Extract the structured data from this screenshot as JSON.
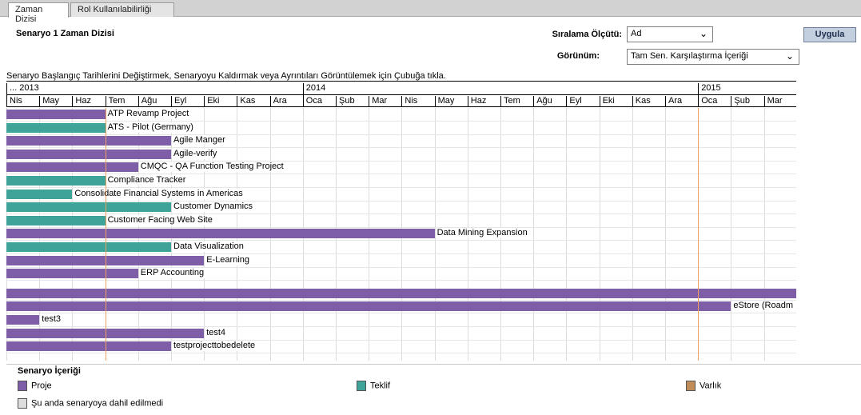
{
  "tabs": [
    {
      "label": "Zaman Dizisi",
      "active": true
    },
    {
      "label": "Rol Kullanılabilirliği",
      "active": false
    }
  ],
  "page_title": "Senaryo 1 Zaman Dizisi",
  "controls": {
    "sort_label": "Sıralama Ölçütü:",
    "sort_value": "Ad",
    "view_label": "Görünüm:",
    "view_value": "Tam Sen. Karşılaştırma İçeriği",
    "apply_label": "Uygula"
  },
  "instruction": "Senaryo Başlangıç Tarihlerini Değiştirmek, Senaryoyu Kaldırmak veya Ayrıntıları Görüntülemek için Çubuğa tıkla.",
  "timeline": {
    "years": [
      "... 2013",
      "2014",
      "2015"
    ],
    "months": [
      "Nis",
      "May",
      "Haz",
      "Tem",
      "Ağu",
      "Eyl",
      "Eki",
      "Kas",
      "Ara",
      "Oca",
      "Şub",
      "Mar",
      "Nis",
      "May",
      "Haz",
      "Tem",
      "Ağu",
      "Eyl",
      "Eki",
      "Kas",
      "Ara",
      "Oca",
      "Şub",
      "Mar"
    ],
    "rows": [
      {
        "name": "ATP Revamp Project",
        "type": "proj",
        "start": 0,
        "end": 3
      },
      {
        "name": "ATS - Pilot (Germany)",
        "type": "prop",
        "start": 0,
        "end": 3
      },
      {
        "name": "Agile Manger",
        "type": "proj",
        "start": 0,
        "end": 5
      },
      {
        "name": "Agile-verify",
        "type": "proj",
        "start": 0,
        "end": 5
      },
      {
        "name": "CMQC - QA Function Testing Project",
        "type": "proj",
        "start": 0,
        "end": 4
      },
      {
        "name": "Compliance Tracker",
        "type": "prop",
        "start": 0,
        "end": 3
      },
      {
        "name": "Consolidate Financial Systems in Americas",
        "type": "prop",
        "start": 0,
        "end": 2
      },
      {
        "name": "Customer Dynamics",
        "type": "prop",
        "start": 0,
        "end": 5
      },
      {
        "name": "Customer Facing Web Site",
        "type": "prop",
        "start": 0,
        "end": 3
      },
      {
        "name": "Data Mining Expansion",
        "type": "proj",
        "start": 0,
        "end": 13
      },
      {
        "name": "Data Visualization",
        "type": "prop",
        "start": 0,
        "end": 5
      },
      {
        "name": "E-Learning",
        "type": "proj",
        "start": 0,
        "end": 6
      },
      {
        "name": "ERP Accounting",
        "type": "proj",
        "start": 0,
        "end": 4
      },
      {
        "name": "",
        "type": "proj",
        "start": 0,
        "end": 24
      },
      {
        "name": "eStore (Roadm",
        "type": "proj",
        "start": 0,
        "end": 22
      },
      {
        "name": "test3",
        "type": "proj",
        "start": 0,
        "end": 1
      },
      {
        "name": "test4",
        "type": "proj",
        "start": 0,
        "end": 6
      },
      {
        "name": "testprojecttobedelete",
        "type": "proj",
        "start": 0,
        "end": 5
      }
    ]
  },
  "legend": {
    "title": "Senaryo İçeriği",
    "items": [
      {
        "label": "Proje",
        "color": "#7f5ea8"
      },
      {
        "label": "Teklif",
        "color": "#3ea398"
      },
      {
        "label": "Varlık",
        "color": "#c08d5a"
      },
      {
        "label": "Şu anda senaryoya dahil edilmedi",
        "color": "#dddddd"
      }
    ]
  }
}
